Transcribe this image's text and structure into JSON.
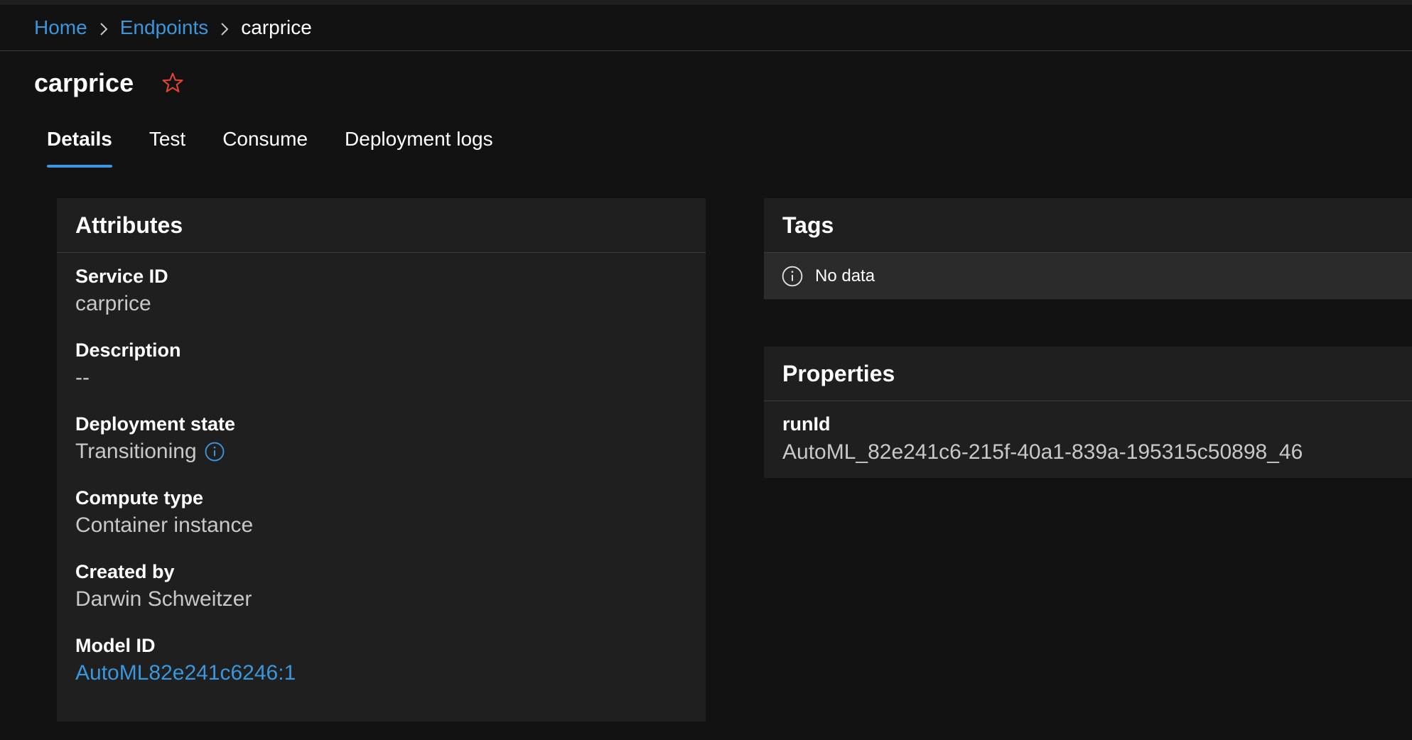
{
  "breadcrumb": {
    "home": "Home",
    "endpoints": "Endpoints",
    "current": "carprice"
  },
  "page": {
    "title": "carprice",
    "star_icon": "star-outline-icon",
    "star_color": "#e0442e"
  },
  "tabs": [
    {
      "label": "Details",
      "active": true
    },
    {
      "label": "Test",
      "active": false
    },
    {
      "label": "Consume",
      "active": false
    },
    {
      "label": "Deployment logs",
      "active": false
    }
  ],
  "attributes": {
    "title": "Attributes",
    "items": [
      {
        "label": "Service ID",
        "value": "carprice"
      },
      {
        "label": "Description",
        "value": "--"
      },
      {
        "label": "Deployment state",
        "value": "Transitioning",
        "icon": "info-icon"
      },
      {
        "label": "Compute type",
        "value": "Container instance"
      },
      {
        "label": "Created by",
        "value": "Darwin Schweitzer"
      },
      {
        "label": "Model ID",
        "value": "AutoML82e241c6246:1",
        "link": true
      }
    ]
  },
  "tags": {
    "title": "Tags",
    "empty_text": "No data",
    "icon": "info-icon"
  },
  "properties": {
    "title": "Properties",
    "items": [
      {
        "label": "runId",
        "value": "AutoML_82e241c6-215f-40a1-839a-195315c50898_46"
      }
    ]
  },
  "colors": {
    "background": "#121212",
    "card": "#1f1f1f",
    "accent": "#3a96dd",
    "muted_text": "#c8c8c8"
  }
}
